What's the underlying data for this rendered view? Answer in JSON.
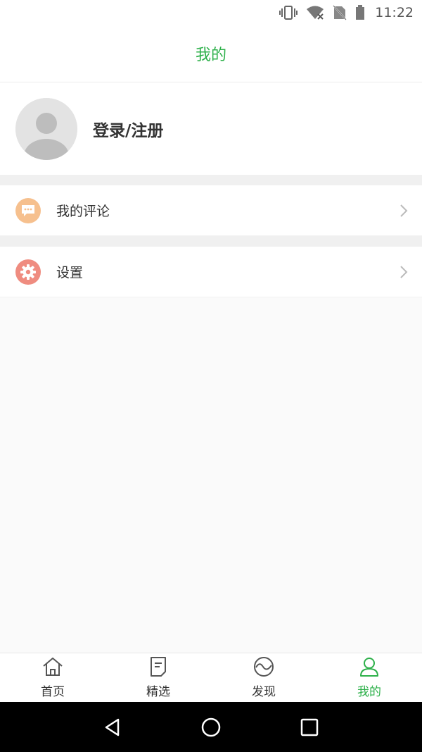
{
  "status_bar": {
    "time": "11:22",
    "icons": [
      "vibrate-icon",
      "wifi-off-icon",
      "no-sim-icon",
      "battery-icon"
    ]
  },
  "header": {
    "title": "我的"
  },
  "profile": {
    "login_label": "登录/注册",
    "avatar_icon": "default-avatar-icon"
  },
  "menu": {
    "items": [
      {
        "label": "我的评论",
        "icon": "comment-icon",
        "icon_color": "#f6c08e"
      },
      {
        "label": "设置",
        "icon": "gear-icon",
        "icon_color": "#ef8c80"
      }
    ]
  },
  "tab_bar": {
    "tabs": [
      {
        "label": "首页",
        "icon": "home-icon",
        "active": false
      },
      {
        "label": "精选",
        "icon": "document-icon",
        "active": false
      },
      {
        "label": "发现",
        "icon": "discover-icon",
        "active": false
      },
      {
        "label": "我的",
        "icon": "person-icon",
        "active": true
      }
    ]
  },
  "colors": {
    "accent": "#2db04a",
    "text": "#333333",
    "background": "#fafafa"
  },
  "system_nav": {
    "buttons": [
      "back-icon",
      "home-circle-icon",
      "recents-icon"
    ]
  }
}
